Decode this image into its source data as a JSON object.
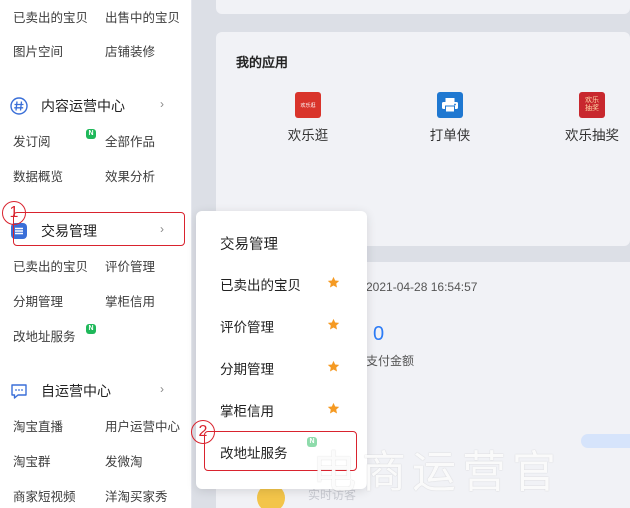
{
  "sidebar": {
    "top_links": [
      "已卖出的宝贝",
      "出售中的宝贝",
      "图片空间",
      "店铺装修"
    ],
    "content_center": {
      "title": "内容运营中心",
      "links": [
        "发订阅",
        "全部作品",
        "数据概览",
        "效果分析"
      ]
    },
    "trade": {
      "title": "交易管理",
      "links": [
        "已卖出的宝贝",
        "评价管理",
        "分期管理",
        "掌柜信用",
        "改地址服务"
      ]
    },
    "self_center": {
      "title": "自运营中心",
      "links": [
        "淘宝直播",
        "用户运营中心",
        "淘宝群",
        "发微淘",
        "商家短视频",
        "洋淘买家秀"
      ]
    },
    "new_badge": "N",
    "chevron": "›"
  },
  "apps": {
    "title": "我的应用",
    "items": [
      {
        "label": "欢乐逛",
        "icon_text": "欢乐逛",
        "color": "#d9342b",
        "icon": "happy-shopping-icon"
      },
      {
        "label": "打单侠",
        "icon_text": "",
        "color": "#1f78d1",
        "icon": "printer-icon"
      },
      {
        "label": "欢乐抽奖",
        "icon_text": "欢乐抽奖",
        "color": "#c8282e",
        "icon": "lottery-icon"
      }
    ]
  },
  "stats": {
    "time": "2021-04-28 16:54:57",
    "value": "0",
    "label": "支付金额",
    "realtime": "实时访客"
  },
  "popup": {
    "title": "交易管理",
    "items": [
      "已卖出的宝贝",
      "评价管理",
      "分期管理",
      "掌柜信用",
      "改地址服务"
    ]
  },
  "annotations": {
    "one": "1",
    "two": "2"
  },
  "watermark": "电商运营官",
  "colors": {
    "accent_red": "#d9232e",
    "star": "#f59a23",
    "value_blue": "#2d7cf6",
    "badge_green": "#1fb85a"
  }
}
